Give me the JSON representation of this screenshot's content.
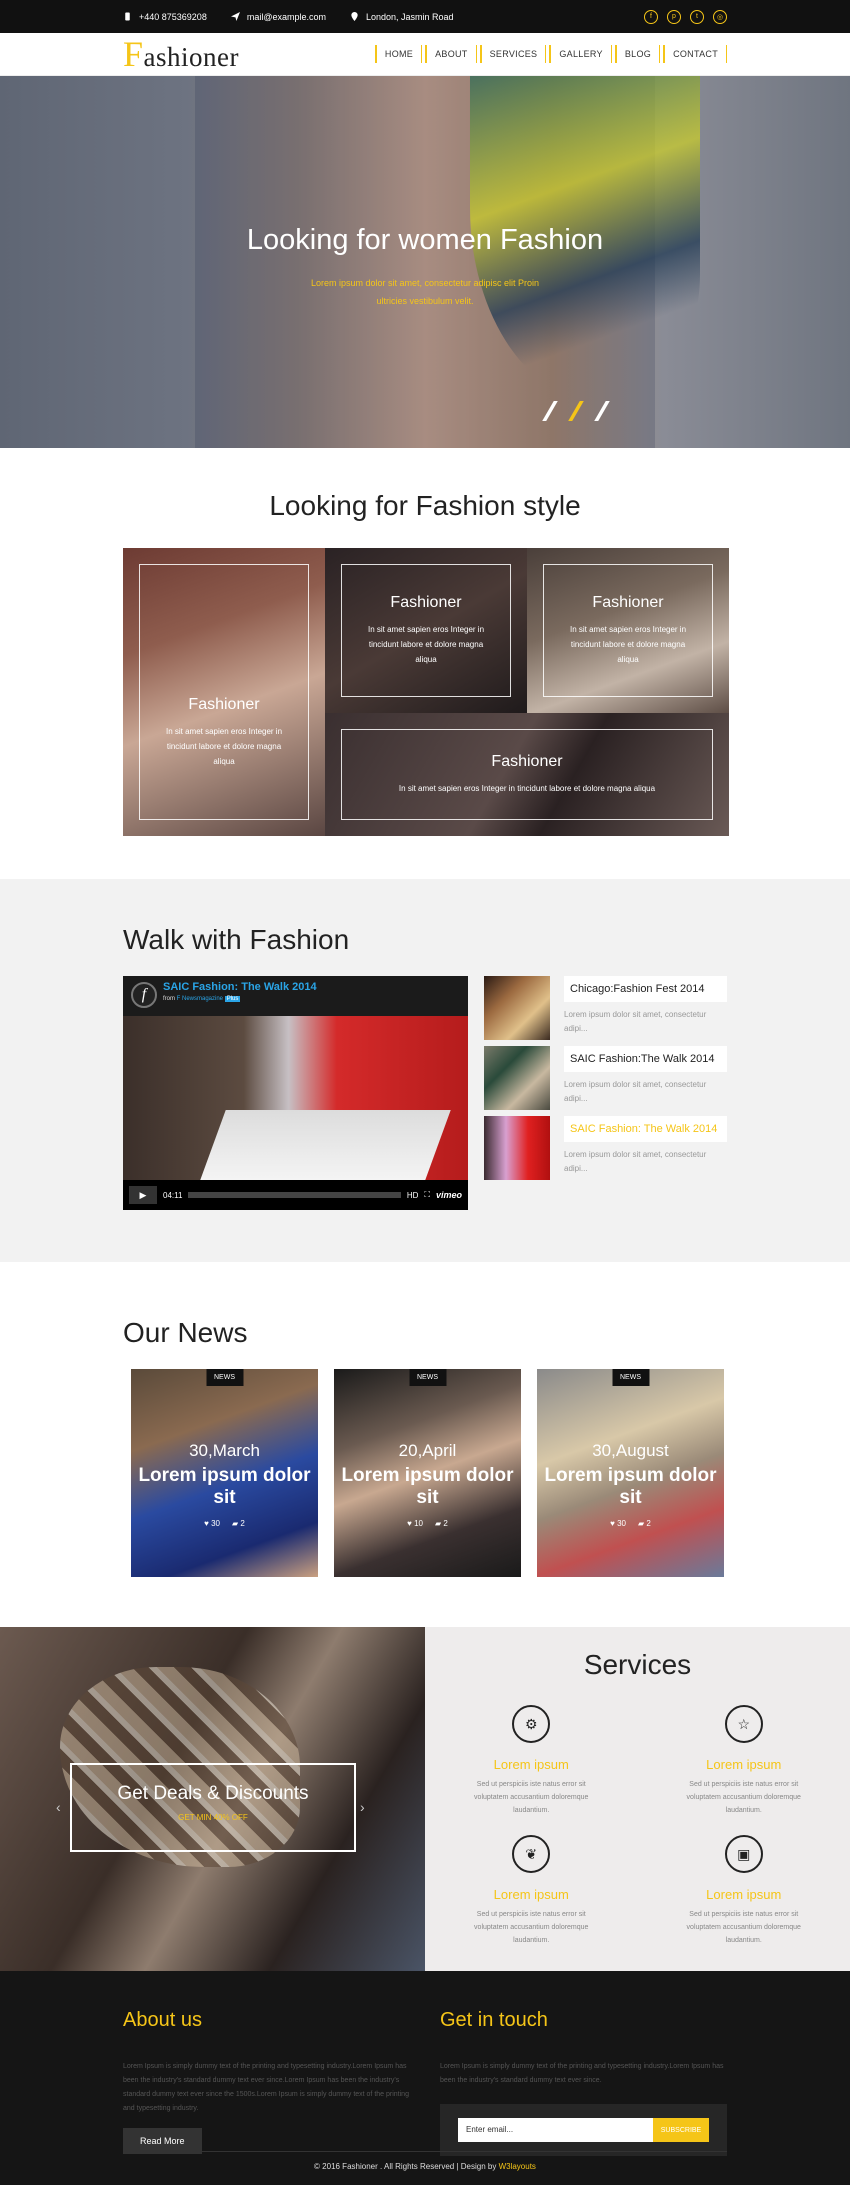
{
  "topbar": {
    "phone": "+440 875369208",
    "email": "mail@example.com",
    "location": "London, Jasmin Road",
    "social_icons": [
      "facebook-icon",
      "pinterest-icon",
      "twitter-icon",
      "instagram-icon"
    ]
  },
  "header": {
    "logo_initial": "F",
    "logo_rest": "ashioner",
    "nav": [
      "HOME",
      "ABOUT",
      "SERVICES",
      "GALLERY",
      "BLOG",
      "CONTACT"
    ]
  },
  "hero": {
    "title": "Looking for women Fashion",
    "subtitle": "Lorem ipsum dolor sit amet, consectetur adipisc elit Proin ultricies vestibulum velit."
  },
  "style_section": {
    "title": "Looking for Fashion style",
    "tiles": [
      {
        "title": "Fashioner",
        "text": "In sit amet sapien eros Integer in tincidunt labore et dolore magna aliqua"
      },
      {
        "title": "Fashioner",
        "text": "In sit amet sapien eros Integer in tincidunt labore et dolore magna aliqua"
      },
      {
        "title": "Fashioner",
        "text": "In sit amet sapien eros Integer in tincidunt labore et dolore magna aliqua"
      },
      {
        "title": "Fashioner",
        "text": "In sit amet sapien eros Integer in tincidunt labore et dolore magna aliqua"
      }
    ]
  },
  "walk": {
    "title": "Walk with Fashion",
    "video": {
      "title": "SAIC Fashion: The Walk 2014",
      "from": "from",
      "channel": "F Newsmagazine",
      "badge": "Plus",
      "time": "04:11",
      "quality": "HD",
      "brand": "vimeo"
    },
    "items": [
      {
        "title": "Chicago:Fashion Fest 2014",
        "desc": "Lorem ipsum dolor sit amet, consectetur adipi..."
      },
      {
        "title": "SAIC Fashion:The Walk 2014",
        "desc": "Lorem ipsum dolor sit amet, consectetur adipi..."
      },
      {
        "title": "SAIC Fashion: The Walk 2014",
        "desc": "Lorem ipsum dolor sit amet, consectetur adipi..."
      }
    ]
  },
  "news": {
    "title": "Our News",
    "cards": [
      {
        "tag": "NEWS",
        "date": "30,March",
        "headline": "Lorem ipsum dolor sit",
        "views": "30",
        "comments": "2"
      },
      {
        "tag": "NEWS",
        "date": "20,April",
        "headline": "Lorem ipsum dolor sit",
        "views": "10",
        "comments": "2"
      },
      {
        "tag": "NEWS",
        "date": "30,August",
        "headline": "Lorem ipsum dolor sit",
        "views": "30",
        "comments": "2"
      }
    ]
  },
  "deals": {
    "title": "Get Deals & Discounts",
    "subtitle": "GET MIN 40% OFF",
    "prev": "‹",
    "next": "›"
  },
  "services": {
    "title": "Services",
    "items": [
      {
        "icon": "gear-icon",
        "glyph": "⚙",
        "title": "Lorem ipsum",
        "text": "Sed ut perspiciis iste natus error sit voluptatem accusantium doloremque laudantium."
      },
      {
        "icon": "star-icon",
        "glyph": "☆",
        "title": "Lorem ipsum",
        "text": "Sed ut perspiciis iste natus error sit voluptatem accusantium doloremque laudantium."
      },
      {
        "icon": "leaf-icon",
        "glyph": "❦",
        "title": "Lorem ipsum",
        "text": "Sed ut perspiciis iste natus error sit voluptatem accusantium doloremque laudantium."
      },
      {
        "icon": "gift-icon",
        "glyph": "▣",
        "title": "Lorem ipsum",
        "text": "Sed ut perspiciis iste natus error sit voluptatem accusantium doloremque laudantium."
      }
    ]
  },
  "footer": {
    "about_title": "About us",
    "about_text": "Lorem Ipsum is simply dummy text of the printing and typesetting industry.Lorem Ipsum has been the industry's standard dummy text ever since.Lorem Ipsum has been the industry's standard dummy text ever since the 1500s.Lorem Ipsum is simply dummy text of the printing and typesetting industry.",
    "read_more": "Read More",
    "contact_title": "Get in touch",
    "contact_text": "Lorem Ipsum is simply dummy text of the printing and typesetting industry.Lorem Ipsum has been the industry's standard dummy text ever since.",
    "email_placeholder": "Enter email...",
    "subscribe": "SUBSCRIBE",
    "copyright": "© 2016 Fashioner . All Rights Reserved | Design by",
    "designer": "W3layouts"
  },
  "colors": {
    "accent": "#f5c518",
    "dark": "#111111",
    "footer": "#151515"
  }
}
